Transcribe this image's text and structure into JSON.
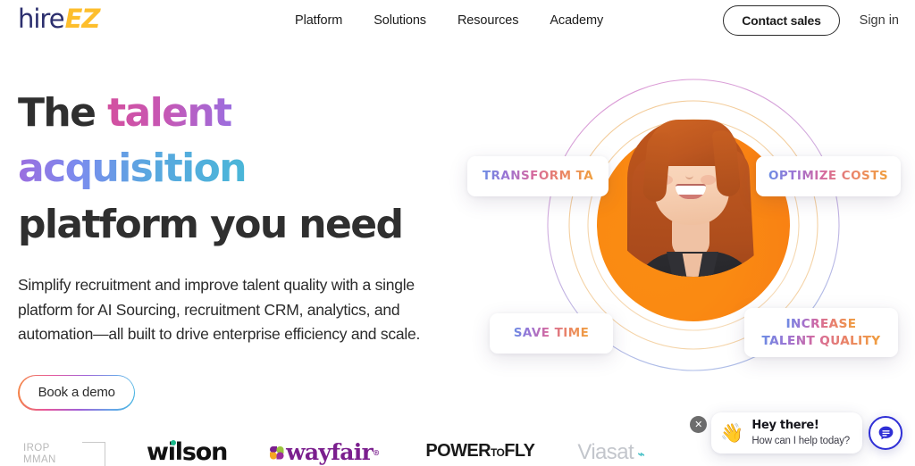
{
  "brand": {
    "logo_primary": "hire",
    "logo_accent": "EZ",
    "primary_color": "#2c2f6e",
    "accent_color": "#fdbe2c"
  },
  "header": {
    "nav_items": [
      {
        "label": "Platform"
      },
      {
        "label": "Solutions"
      },
      {
        "label": "Resources"
      },
      {
        "label": "Academy"
      }
    ],
    "contact_sales_label": "Contact sales",
    "sign_in_label": "Sign in"
  },
  "hero": {
    "headline": {
      "line1_plain": "The ",
      "line1_gradient": "talent acquisition",
      "line2": "platform you need",
      "gradient_from": "#d3509f",
      "gradient_to": "#4ab6d8"
    },
    "subtext": "Simplify recruitment and improve talent quality with a single platform for AI Sourcing, recruitment CRM, analytics, and automation—all built to drive enterprise efficiency and scale.",
    "cta_label": "Book a demo",
    "cta_border_gradient": "#f6883f → #41b4e0"
  },
  "visual": {
    "chips": [
      {
        "id": "transform",
        "label": "TRANSFORM TA"
      },
      {
        "id": "optimize",
        "label": "OPTIMIZE COSTS"
      },
      {
        "id": "save",
        "label": "SAVE TIME"
      },
      {
        "id": "increase",
        "line1": "INCREASE",
        "line2": "TALENT QUALITY"
      }
    ],
    "photo_background_color": "#fa8a12",
    "ring_colors": [
      "#d8a3d8",
      "#f3c98a",
      "#f3c98a",
      "#b6c4ea"
    ]
  },
  "logos": [
    {
      "id": "northrop-grumman",
      "line1": "IROP",
      "line2": "MMAN"
    },
    {
      "id": "wilson",
      "text": "wilson",
      "dot_color": "#19b98b"
    },
    {
      "id": "wayfair",
      "text": "wayfair",
      "tm": "®",
      "color": "#7b1f8e"
    },
    {
      "id": "powertofly",
      "text": "POWER",
      "small": "TO",
      "text2": "FLY"
    },
    {
      "id": "viasat",
      "text": "Viasat",
      "accent": "#4fc3c9"
    }
  ],
  "chat_widget": {
    "close_label": "✕",
    "wave_icon": "👋",
    "title": "Hey there!",
    "subtitle": "How can I help today?",
    "fab_color": "#2f2fd6"
  }
}
